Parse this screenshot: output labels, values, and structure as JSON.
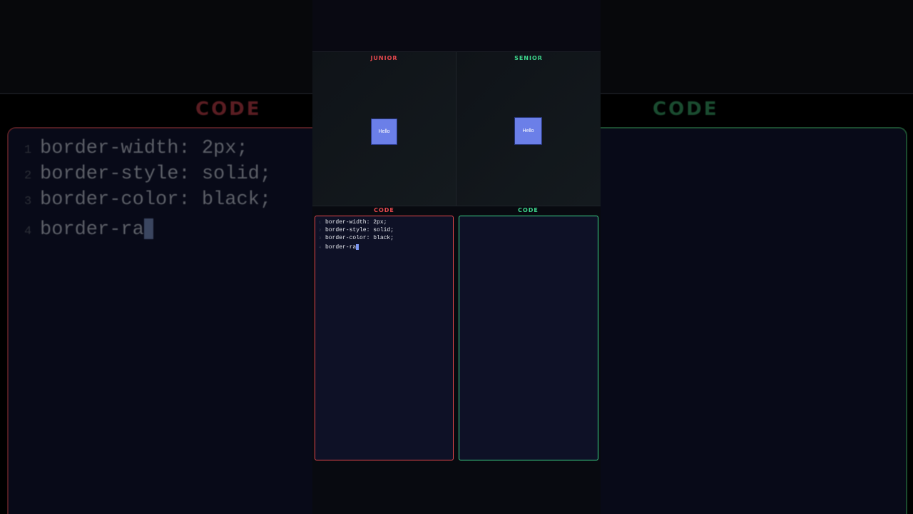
{
  "panels": {
    "junior_title": "JUNIOR",
    "senior_title": "SENIOR"
  },
  "preview": {
    "junior_button": "Hello",
    "senior_button": "Hello"
  },
  "code_labels": {
    "left": "CODE",
    "right": "CODE"
  },
  "junior_code": {
    "lines": [
      {
        "num": "1",
        "text": "border-width: 2px;"
      },
      {
        "num": "2",
        "text": "border-style: solid;"
      },
      {
        "num": "3",
        "text": "border-color: black;"
      },
      {
        "num": "4",
        "text": "border-ra"
      }
    ]
  },
  "colors": {
    "junior_accent": "#e5484d",
    "senior_accent": "#3dd68c",
    "button_fill": "#6b7fe8",
    "editor_bg": "#0e1126",
    "cursor": "#7c95f0"
  },
  "icons": {
    "cursor": "text-cursor-block"
  }
}
